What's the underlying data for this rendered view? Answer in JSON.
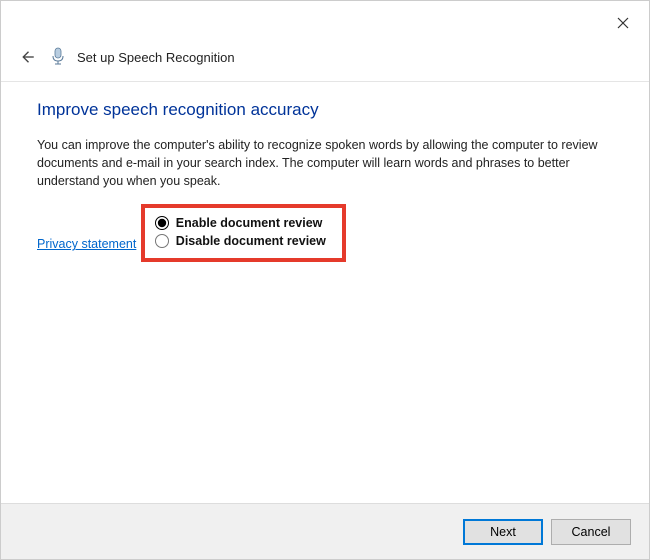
{
  "window": {
    "title": "Set up Speech Recognition"
  },
  "page": {
    "heading": "Improve speech recognition accuracy",
    "description": "You can improve the computer's ability to recognize spoken words by allowing the computer to review documents and e-mail in your search index. The computer will learn words and phrases to better understand you when you speak.",
    "privacy_link": "Privacy statement"
  },
  "options": {
    "enable_label": "Enable document review",
    "disable_label": "Disable document review",
    "selected": "enable"
  },
  "footer": {
    "next": "Next",
    "cancel": "Cancel"
  }
}
